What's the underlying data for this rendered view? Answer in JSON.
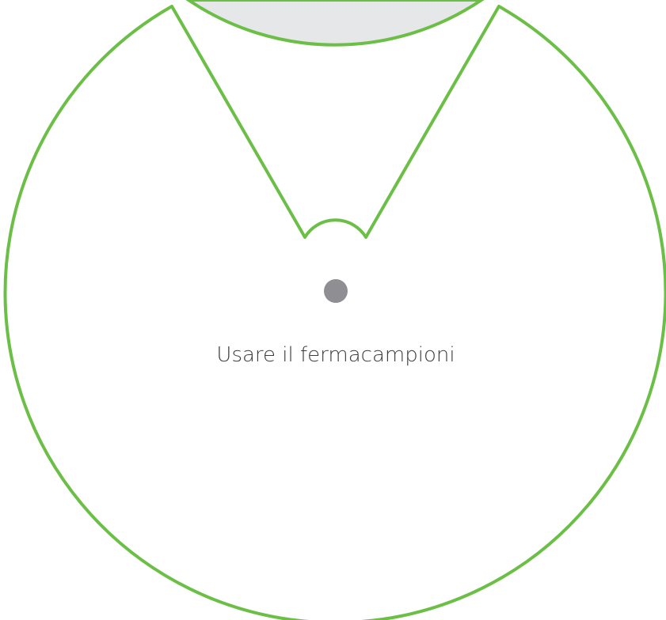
{
  "template": {
    "caption": "Usare il fermacampioni",
    "colors": {
      "outline": "#6cbf46",
      "top_fill": "#e6e7e9",
      "pin": "#8e8e93",
      "text": "#3d3d3d",
      "background": "#ffffff"
    }
  }
}
